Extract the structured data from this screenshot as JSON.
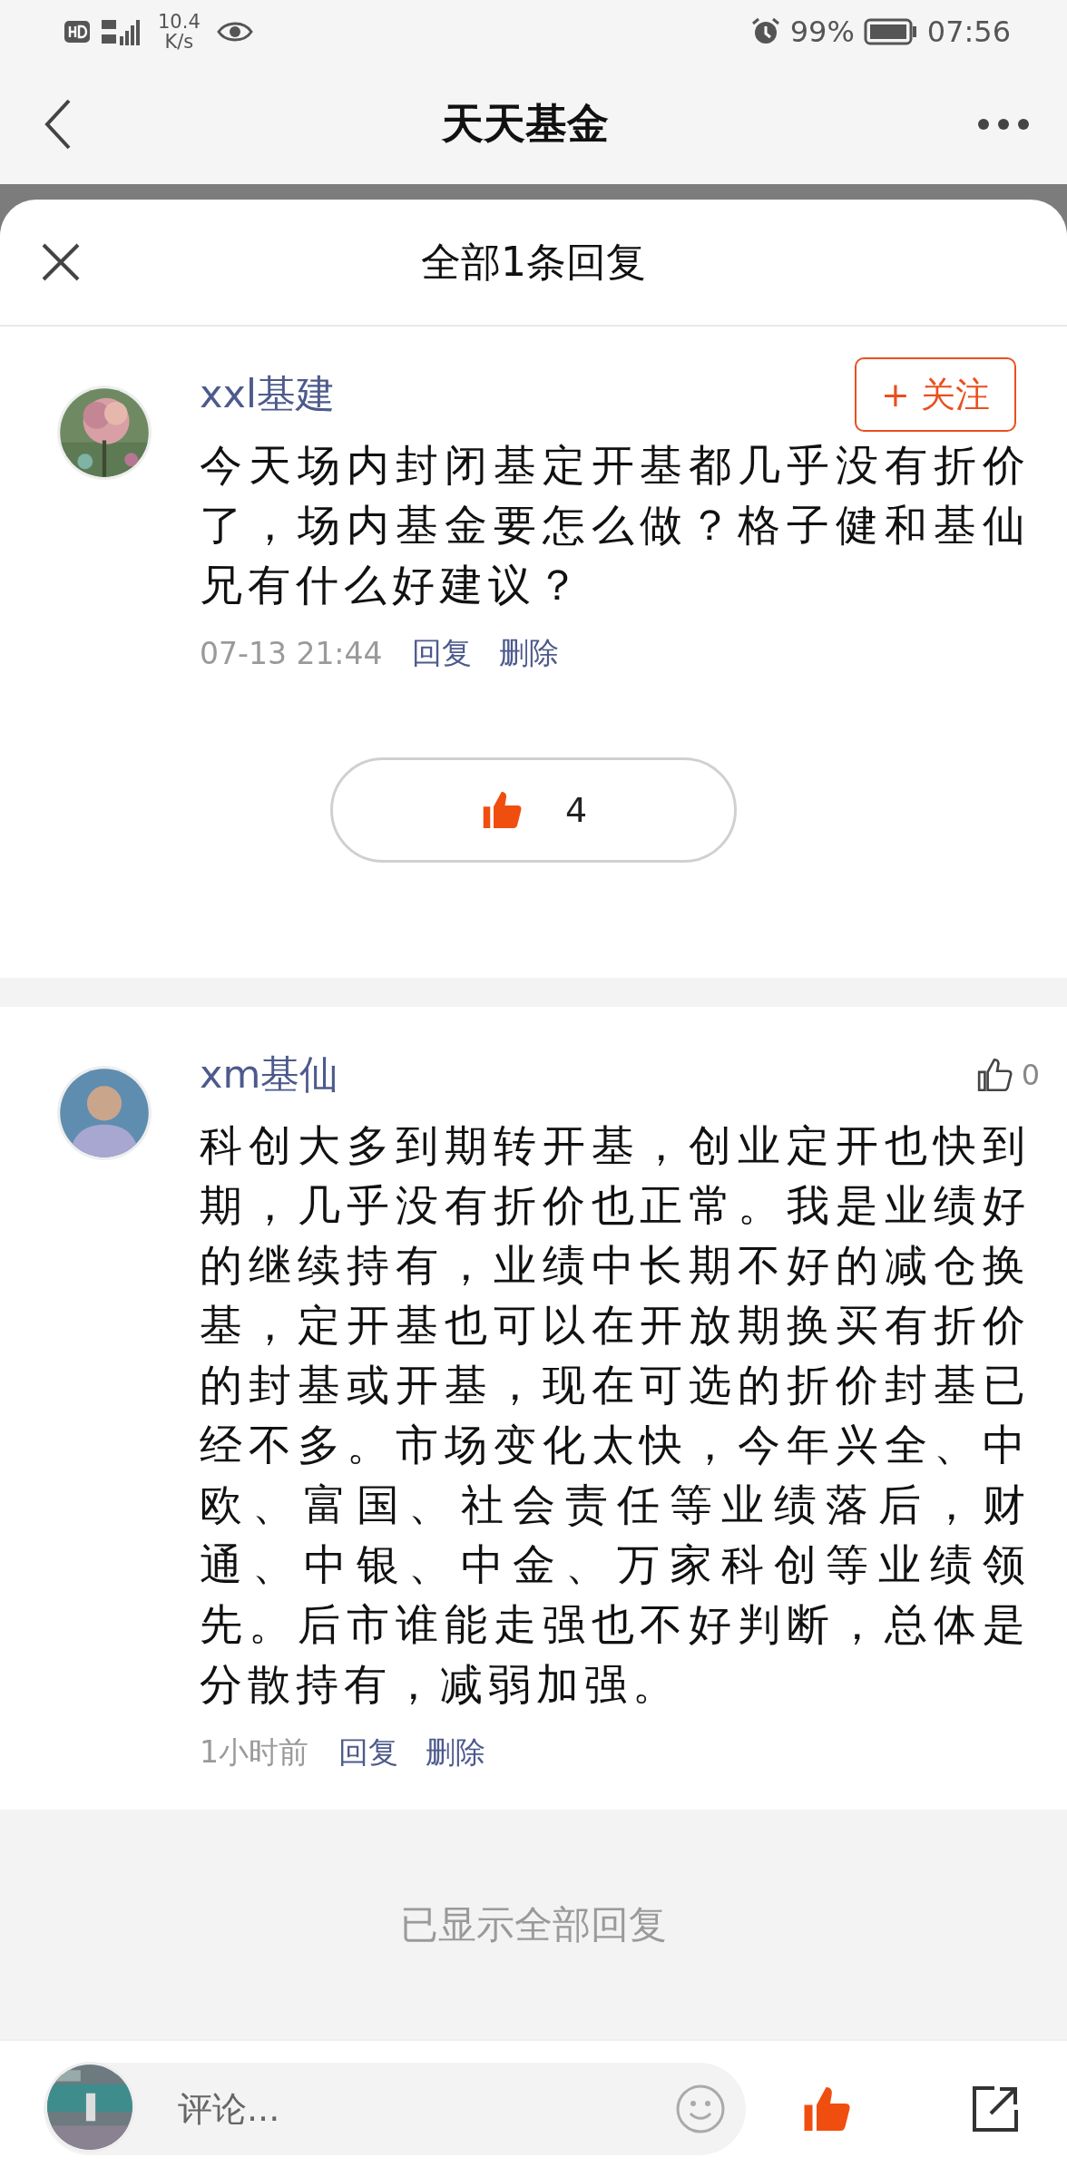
{
  "status_bar": {
    "network_speed": "10.4",
    "speed_unit": "K/s",
    "battery": "99%",
    "time": "07:56"
  },
  "nav": {
    "title": "天天基金"
  },
  "sheet": {
    "title": "全部1条回复"
  },
  "comment": {
    "author": "xxl基建",
    "follow_label": "+ 关注",
    "text": "今天场内封闭基定开基都几乎没有折价了，场内基金要怎么做？格子健和基仙兄有什么好建议？",
    "time": "07-13 21:44",
    "actions": [
      "回复",
      "删除"
    ],
    "like_count": "4",
    "liked": true
  },
  "replies": [
    {
      "author": "xm基仙",
      "text": "科创大多到期转开基，创业定开也快到期，几乎没有折价也正常。我是业绩好的继续持有，业绩中长期不好的减仓换基，定开基也可以在开放期换买有折价的封基或开基，现在可选的折价封基已经不多。市场变化太快，今年兴全、中欧、富国、社会责任等业绩落后，财通、中银、中金、万家科创等业绩领先。后市谁能走强也不好判断，总体是分散持有，减弱加强。",
      "time": "1小时前",
      "actions": [
        "回复",
        "删除"
      ],
      "like_count": "0",
      "liked": false
    }
  ],
  "footer_note": "已显示全部回复",
  "composer": {
    "placeholder": "评论...",
    "liked": true
  }
}
